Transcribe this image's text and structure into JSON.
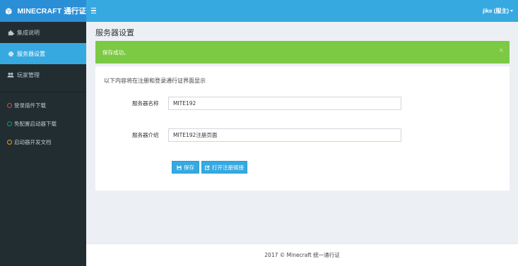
{
  "brand": {
    "title": "MINECRAFT 通行证"
  },
  "topbar": {
    "user_label": "jike (服主)"
  },
  "sidebar": {
    "items": [
      {
        "label": "集成说明",
        "icon": "puzzle-icon"
      },
      {
        "label": "服务器设置",
        "icon": "gear-icon",
        "active": true
      },
      {
        "label": "玩家管理",
        "icon": "users-icon"
      }
    ],
    "links": [
      {
        "label": "登录插件下载",
        "color": "#dd4b39"
      },
      {
        "label": "免配置启动器下载",
        "color": "#00a65a"
      },
      {
        "label": "启动器开发文档",
        "color": "#f39c12"
      }
    ]
  },
  "page": {
    "title": "服务器设置"
  },
  "alert": {
    "message": "保存成功。",
    "close": "×"
  },
  "form": {
    "intro": "以下内容将在注册和登录通行证界面显示",
    "server_name_label": "服务器名称",
    "server_name_value": "MITE192",
    "server_intro_label": "服务器介绍",
    "server_intro_value": "MITE192注册页面",
    "save_label": "保存",
    "open_link_label": "打开注册链接"
  },
  "footer": {
    "text": "2017 © Minecraft 统一通行证"
  },
  "colors": {
    "accent": "#36a9e1",
    "success": "#7cc944",
    "sidebar": "#222d32"
  }
}
